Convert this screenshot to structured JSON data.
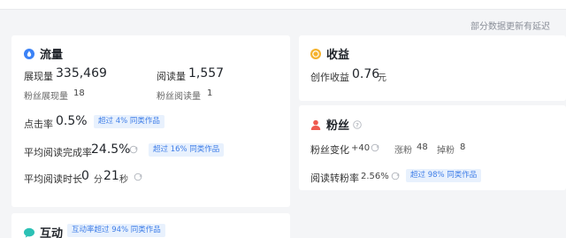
{
  "notice": "部分数据更新有延迟",
  "traffic": {
    "title": "流量",
    "impressions_label": "展现量",
    "impressions_value": "335,469",
    "reads_label": "阅读量",
    "reads_value": "1,557",
    "fan_impressions_label": "粉丝展现量",
    "fan_impressions_value": "18",
    "fan_reads_label": "粉丝阅读量",
    "fan_reads_value": "1",
    "ctr_label": "点击率",
    "ctr_value": "0.5%",
    "ctr_badge": "超过 4% 同类作品",
    "completion_label": "平均阅读完成率",
    "completion_value": "24.5%",
    "completion_badge": "超过 16% 同类作品",
    "duration_label": "平均阅读时长",
    "duration_min": "0",
    "duration_min_unit": "分",
    "duration_sec": "21",
    "duration_sec_unit": "秒"
  },
  "income": {
    "title": "收益",
    "creation_label": "创作收益",
    "creation_value": "0.76",
    "creation_unit": "元"
  },
  "fans": {
    "title": "粉丝",
    "change_label": "粉丝变化",
    "change_value": "+40",
    "gain_label": "涨粉",
    "gain_value": "48",
    "loss_label": "掉粉",
    "loss_value": "8",
    "conversion_label": "阅读转粉率",
    "conversion_value": "2.56%",
    "conversion_badge": "超过 98% 同类作品"
  },
  "interaction": {
    "title": "互动",
    "badge": "互动率超过 94% 同类作品"
  },
  "colors": {
    "traffic_icon": "#3b82f6",
    "income_icon": "#f5b32e",
    "fans_icon": "#ef5a50",
    "interaction_icon": "#2cc1b5",
    "badge_bg": "#e8f1fd",
    "badge_text": "#3f7ee8"
  }
}
